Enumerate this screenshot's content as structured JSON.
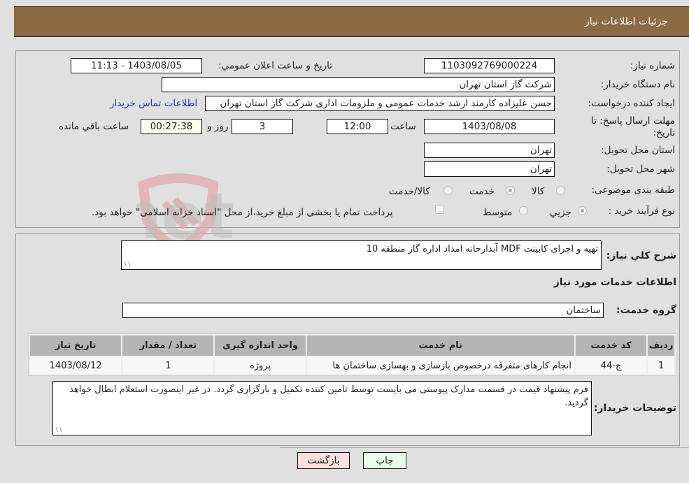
{
  "header": {
    "title": "جزئيات اطلاعات نياز"
  },
  "fields": {
    "need_number": {
      "label": "شماره نياز:",
      "value": "1103092769000224"
    },
    "announce_datetime": {
      "label": "تاريخ و ساعت اعلان عمومي:",
      "value": "1403/08/05 - 11:13"
    },
    "buyer_org": {
      "label": "نام دستگاه خريدار:",
      "value": "شرکت گاز استان تهران"
    },
    "requester": {
      "label": "ايجاد کننده درخواست:",
      "value": "حسن علیزاده کارمند ارشد خدمات عمومی و ملزومات اداری شرکت گاز استان تهران"
    },
    "buyer_contact_link": "اطلاعات تماس خريدار",
    "deadline": {
      "label": "مهلت ارسال پاسخ: تا تاريخ:",
      "date": "1403/08/08",
      "time_label": "ساعت",
      "time": "12:00",
      "days": "3",
      "days_label": "روز و",
      "remaining": "00:27:38",
      "remaining_label": "ساعت باقي مانده"
    },
    "delivery_province": {
      "label": "استان محل تحويل:",
      "value": "تهران"
    },
    "delivery_city": {
      "label": "شهر محل تحويل:",
      "value": "تهران"
    },
    "category": {
      "label": "طبقه بندی موضوعی:",
      "options": [
        {
          "label": "کالا",
          "checked": false
        },
        {
          "label": "خدمت",
          "checked": true
        },
        {
          "label": "کالا/خدمت",
          "checked": false
        }
      ]
    },
    "purchase_type": {
      "label": "نوع فرآيند خريد :",
      "options": [
        {
          "label": "جزيي",
          "checked": true
        },
        {
          "label": "متوسط",
          "checked": false
        }
      ],
      "treasury_checkbox_label": "پرداخت تمام يا بخشی از مبلغ خريد،از محل \"اسناد خزانه اسلامی\" خواهد بود.",
      "treasury_checked": false
    }
  },
  "summary": {
    "label": "شرح کلي نياز:",
    "value": "تهیه و اجرای کابینت MDF آبدارخانه امداد اداره گاز منطقه 10"
  },
  "services_section_title": "اطلاعات خدمات مورد نياز",
  "service_group": {
    "label": "گروه خدمت:",
    "value": "ساختمان"
  },
  "table": {
    "headers": [
      "رديف",
      "کد خدمت",
      "نام خدمت",
      "واحد اندازه گيری",
      "تعداد / مقدار",
      "تاريخ نياز"
    ],
    "rows": [
      [
        "1",
        "ج-44",
        "انجام کارهای متفرقه درخصوص بازسازی و بهسازی ساختمان ها",
        "پروژه",
        "1",
        "1403/08/12"
      ]
    ]
  },
  "buyer_notes": {
    "label": "توضيحات خريدار:",
    "value": "فرم پیشنهاد قیمت در قسمت مدارک پیوستی می بایست توسط تامین کننده تکمیل و بارگزاری گردد. در غیر اینصورت استعلام ابطال خواهد گردید."
  },
  "buttons": {
    "print": "چاپ",
    "back": "بازگشت"
  },
  "watermark": {
    "text": "AriaTender.net"
  },
  "colors": {
    "header_bg": "#8b6b43",
    "link": "#1a35c8",
    "back_btn": "#ffe0e0",
    "print_btn": "#eaffea"
  }
}
